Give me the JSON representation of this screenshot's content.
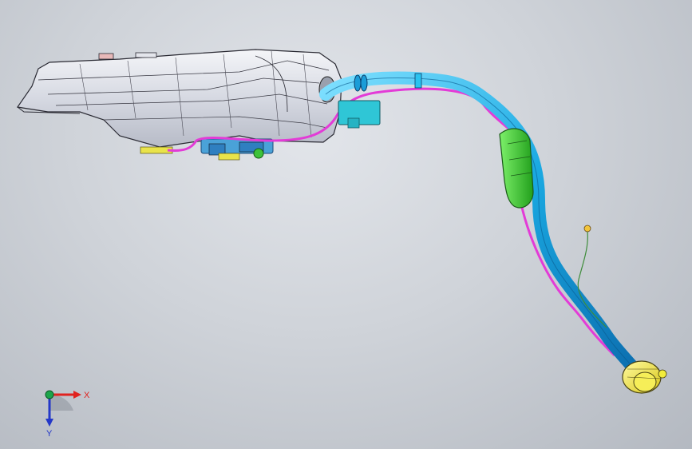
{
  "triad": {
    "x_label": "X",
    "y_label": "Y",
    "x_color": "#e0231f",
    "y_color": "#2438c8",
    "origin_color": "#1ca54a"
  },
  "colors": {
    "tank_body": "#dde0e8",
    "tank_edge": "#2a2a33",
    "filler_pipe": "#22b7e8",
    "vent_line": "#e33bd7",
    "canister": "#46d238",
    "filler_cap": "#f2ec3a",
    "bracket": "#2fc6d6",
    "pump_module": "#4aa2d8"
  },
  "icons": [
    "coordinate-triad-icon",
    "view-orientation-icon"
  ]
}
